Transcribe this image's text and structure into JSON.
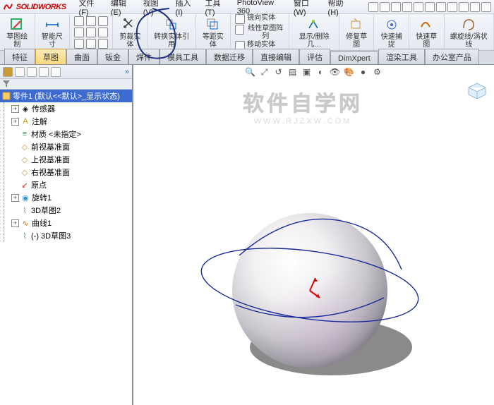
{
  "app": {
    "name": "SOLIDWORKS"
  },
  "menu": {
    "file": "文件(F)",
    "edit": "编辑(E)",
    "view": "视图(V)",
    "insert": "插入(I)",
    "tools": "工具(T)",
    "photoview": "PhotoView 360",
    "window": "窗口(W)",
    "help": "帮助(H)"
  },
  "ribbon": {
    "sketch": "草图绘制",
    "smartdim": "智能尺寸",
    "trim": "剪裁实体",
    "convert": "转换实体引用",
    "offset": "等距实体",
    "mirror": "镜向实体",
    "linear": "线性草图阵列",
    "display": "显示/删除几…",
    "repair": "修复草图",
    "quick": "快速捕捉",
    "rapid": "快速草图",
    "spiral": "螺旋线/涡状线",
    "moveent": "移动实体"
  },
  "tabs": {
    "feature": "特征",
    "sketch": "草图",
    "surface": "曲面",
    "sheetmetal": "钣金",
    "weldment": "焊件",
    "moldtools": "模具工具",
    "datamigr": "数据迁移",
    "directedit": "直接编辑",
    "evaluate": "评估",
    "dimxpert": "DimXpert",
    "rendertools": "渲染工具",
    "office": "办公室产品"
  },
  "tree": {
    "root": "零件1 (默认<<默认>_显示状态)",
    "sensors": "传感器",
    "annotations": "注解",
    "material": "材质 <未指定>",
    "front": "前视基准面",
    "top": "上视基准面",
    "right": "右视基准面",
    "origin": "原点",
    "rev1": "旋转1",
    "sk2": "3D草图2",
    "curve1": "曲线1",
    "sk3": "(-) 3D草图3"
  },
  "watermark": {
    "title": "软件自学网",
    "url": "WWW.RJZXW.COM"
  },
  "colors": {
    "accent": "#3d6bcf",
    "tab_active_bg": "#f8d97e",
    "annot_blue": "#203080"
  }
}
